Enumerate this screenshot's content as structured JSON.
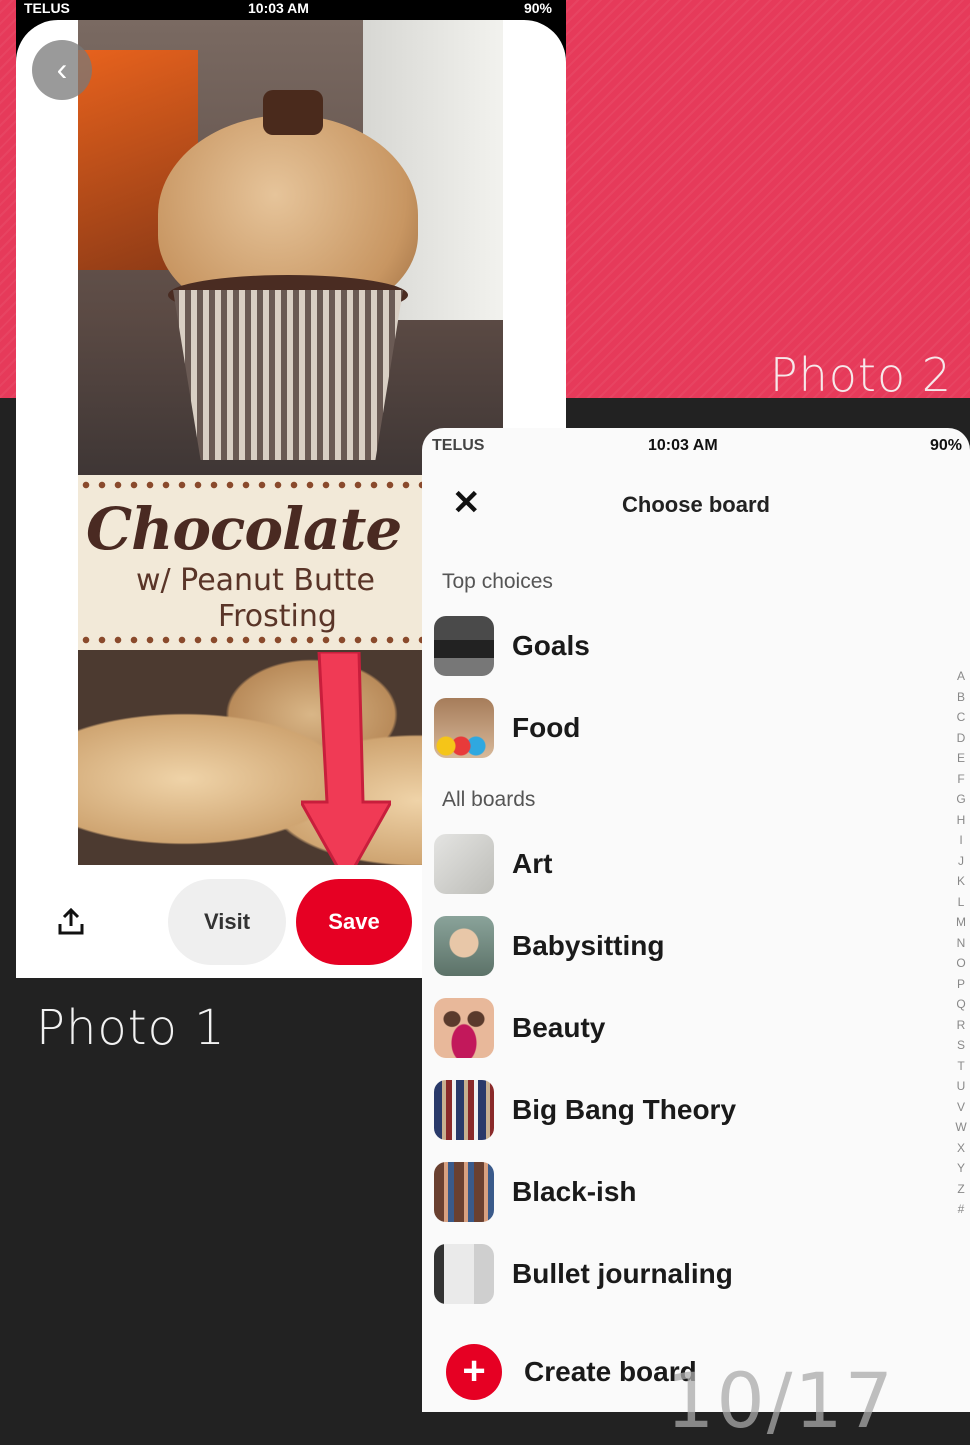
{
  "labels": {
    "photo1": "Photo 1",
    "photo2": "Photo 2",
    "page_counter": "10/17"
  },
  "phone1": {
    "status": {
      "carrier": "TELUS",
      "time": "10:03 AM",
      "battery": "90%"
    },
    "pin_title_line1": "Chocolate Cupca",
    "pin_title_line2": "w/ Peanut Butte",
    "pin_title_line3": "Frosting",
    "visit_label": "Visit",
    "save_label": "Save",
    "icons": {
      "back": "chevron-left-icon",
      "share": "share-icon"
    }
  },
  "phone2": {
    "status": {
      "carrier": "TELUS",
      "time": "10:03 AM",
      "battery": "90%"
    },
    "title": "Choose board",
    "top_choices_label": "Top choices",
    "all_boards_label": "All boards",
    "top_choices": [
      {
        "name": "Goals"
      },
      {
        "name": "Food"
      }
    ],
    "all_boards": [
      {
        "name": "Art"
      },
      {
        "name": "Babysitting"
      },
      {
        "name": "Beauty"
      },
      {
        "name": "Big Bang Theory"
      },
      {
        "name": "Black-ish"
      },
      {
        "name": "Bullet journaling"
      }
    ],
    "create_board_label": "Create board",
    "alphabet": [
      "A",
      "B",
      "C",
      "D",
      "E",
      "F",
      "G",
      "H",
      "I",
      "J",
      "K",
      "L",
      "M",
      "N",
      "O",
      "P",
      "Q",
      "R",
      "S",
      "T",
      "U",
      "V",
      "W",
      "X",
      "Y",
      "Z",
      "#"
    ]
  },
  "colors": {
    "accent": "#e60023",
    "pink_bg": "#e63a5a",
    "dark_bg": "#222222"
  }
}
